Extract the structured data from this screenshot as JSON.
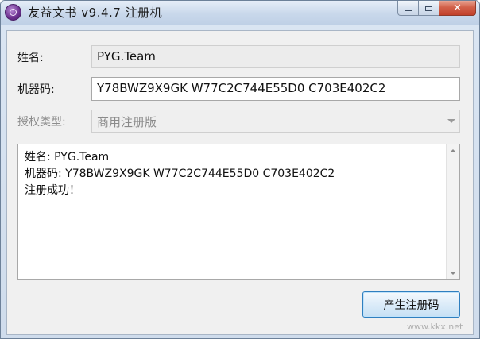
{
  "window": {
    "title": "友益文书 v9.4.7 注册机"
  },
  "form": {
    "name_label": "姓名:",
    "name_value": "PYG.Team",
    "machine_code_label": "机器码:",
    "machine_code_value": "Y78BWZ9X9GK W77C2C744E55D0 C703E402C2",
    "license_type_label": "授权类型:",
    "license_type_value": "商用注册版"
  },
  "output": {
    "lines": [
      "姓名: PYG.Team",
      "机器码: Y78BWZ9X9GK W77C2C744E55D0 C703E402C2",
      "注册成功！"
    ]
  },
  "actions": {
    "generate_label": "产生注册码"
  },
  "watermark": {
    "text": "www.kkx.net"
  },
  "colors": {
    "close_button": "#c1402a",
    "focus_border": "#2f7fbf"
  }
}
